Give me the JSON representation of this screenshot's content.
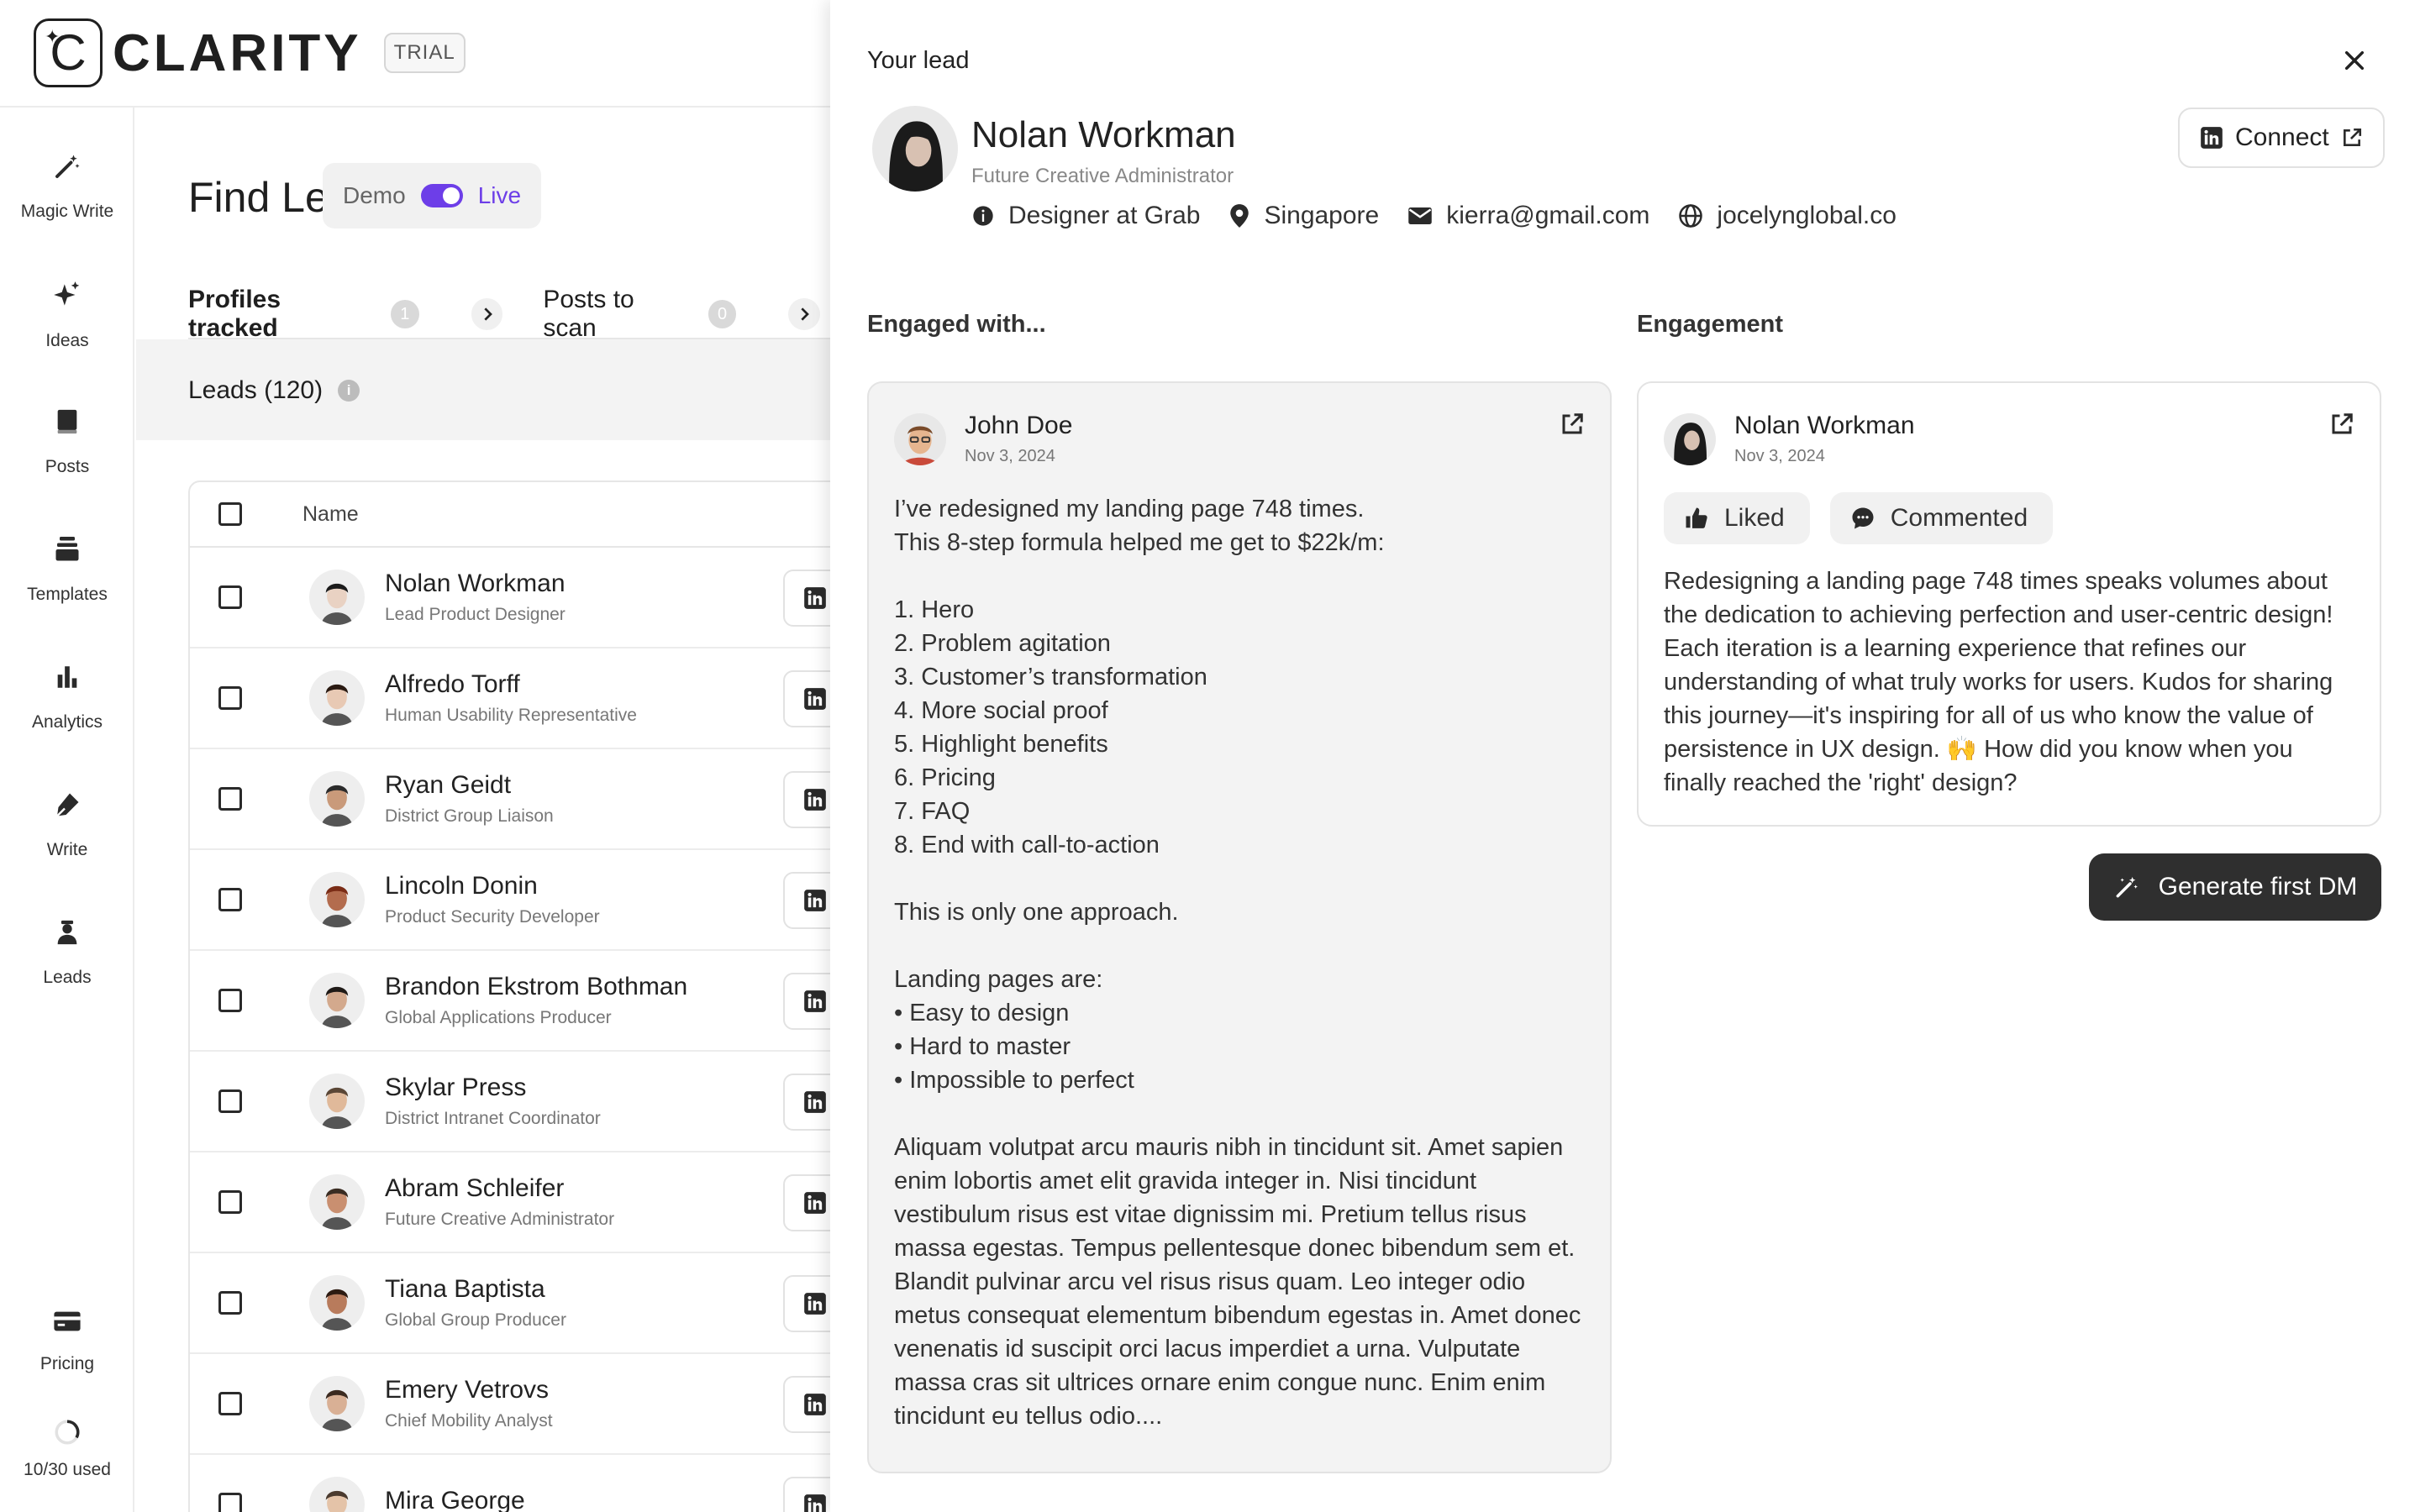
{
  "app": {
    "brand_letter": "C",
    "brand_name": "CLARITY",
    "plan_badge": "TRIAL"
  },
  "sidebar": {
    "items": [
      {
        "label": "Magic Write",
        "icon": "magic-wand-icon"
      },
      {
        "label": "Ideas",
        "icon": "sparkles-icon"
      },
      {
        "label": "Posts",
        "icon": "book-icon"
      },
      {
        "label": "Templates",
        "icon": "stack-icon"
      },
      {
        "label": "Analytics",
        "icon": "bar-chart-icon"
      },
      {
        "label": "Write",
        "icon": "pen-icon"
      },
      {
        "label": "Leads",
        "icon": "person-icon"
      }
    ],
    "pricing_label": "Pricing",
    "usage_label": "10/30 used"
  },
  "main": {
    "title": "Find Leads",
    "mode": {
      "demo_label": "Demo",
      "live_label": "Live"
    },
    "tabs": [
      {
        "label": "Profiles tracked",
        "count": "1"
      },
      {
        "label": "Posts to scan",
        "count": "0"
      }
    ],
    "leads_heading": "Leads (120)",
    "table": {
      "name_header": "Name",
      "rows": [
        {
          "name": "Nolan Workman",
          "role": "Lead Product Designer"
        },
        {
          "name": "Alfredo Torff",
          "role": "Human Usability Representative"
        },
        {
          "name": "Ryan Geidt",
          "role": "District Group Liaison"
        },
        {
          "name": "Lincoln Donin",
          "role": "Product Security Developer"
        },
        {
          "name": "Brandon Ekstrom Bothman",
          "role": "Global Applications Producer"
        },
        {
          "name": "Skylar Press",
          "role": "District Intranet Coordinator"
        },
        {
          "name": "Abram Schleifer",
          "role": "Future Creative Administrator"
        },
        {
          "name": "Tiana Baptista",
          "role": "Global Group Producer"
        },
        {
          "name": "Emery Vetrovs",
          "role": "Chief Mobility Analyst"
        },
        {
          "name": "Mira George",
          "role": ""
        }
      ]
    }
  },
  "drawer": {
    "title": "Your lead",
    "lead": {
      "name": "Nolan Workman",
      "role": "Future Creative Administrator",
      "job": "Designer at Grab",
      "location": "Singapore",
      "email": "kierra@gmail.com",
      "website": "jocelynglobal.co"
    },
    "connect_label": "Connect",
    "engaged_heading": "Engaged with...",
    "engagement_heading": "Engagement",
    "post": {
      "author": "John Doe",
      "date": "Nov 3, 2024",
      "body": "I’ve redesigned my landing page 748 times.\nThis 8-step formula helped me get to $22k/m:\n\n1. Hero\n2. Problem agitation\n3. Customer’s transformation\n4. More social proof\n5. Highlight benefits\n6. Pricing\n7. FAQ\n8. End with call-to-action\n\nThis is only one approach.\n\nLanding pages are:\n• Easy to design\n• Hard to master\n• Impossible to perfect\n\nAliquam volutpat arcu mauris nibh in tincidunt sit. Amet sapien enim lobortis amet elit gravida integer in. Nisi tincidunt vestibulum risus est vitae dignissim mi. Pretium tellus risus massa egestas. Tempus pellentesque donec bibendum sem et. Blandit pulvinar arcu vel risus risus quam. Leo integer odio metus consequat elementum bibendum egestas in. Amet donec venenatis id suscipit orci lacus imperdiet a urna. Vulputate massa cras sit ultrices ornare enim congue nunc. Enim enim tincidunt eu tellus odio...."
    },
    "engagement": {
      "author": "Nolan Workman",
      "date": "Nov 3, 2024",
      "liked_label": "Liked",
      "commented_label": "Commented",
      "comment": "Redesigning a landing page 748 times speaks volumes about the dedication to achieving perfection and user-centric design! Each iteration is a learning experience that refines our understanding of what truly works for users. Kudos for sharing this journey—it's inspiring for all of us who know the value of persistence in UX design. 🙌 How did you know when you finally reached the 'right' design?"
    },
    "generate_label": "Generate first DM"
  },
  "colors": {
    "accent": "#6d3ee8",
    "dark_button": "#2f2f2f",
    "panel_bg": "#f3f3f3"
  }
}
